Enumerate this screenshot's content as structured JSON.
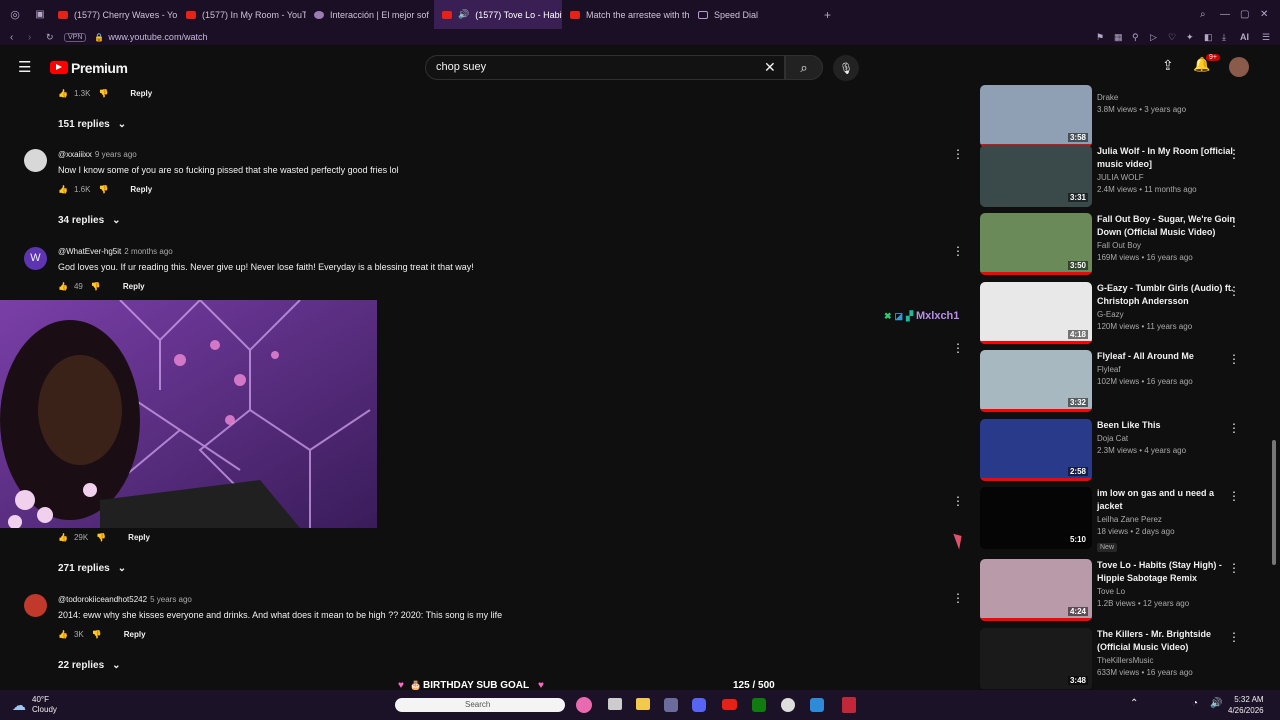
{
  "browser": {
    "tabs": [
      {
        "label": "(1577) Cherry Waves - Yo",
        "kind": "youtube"
      },
      {
        "label": "(1577) In My Room - YouT",
        "kind": "youtube"
      },
      {
        "label": "Interacción | El mejor sof",
        "kind": "other"
      },
      {
        "label": "(1577) Tove Lo - Habit",
        "kind": "youtube",
        "active": true
      },
      {
        "label": "Match the arrestee with th",
        "kind": "other"
      },
      {
        "label": "Speed Dial",
        "kind": "speeddial"
      }
    ],
    "vpn_label": "VPN",
    "url": "www.youtube.com/watch",
    "ai_label": "AI"
  },
  "header": {
    "logo_text": "Premium",
    "search_value": "chop suey",
    "notif_count": "9+"
  },
  "comments": [
    {
      "likes": "1.3K",
      "reply_label": "Reply",
      "replies": "151 replies"
    },
    {
      "author": "@xxaiiixx",
      "time": "9 years ago",
      "text": "Now I know some of you are so fucking pissed that she wasted perfectly good fries lol",
      "likes": "1.6K",
      "reply_label": "Reply",
      "replies": "34 replies"
    },
    {
      "author": "@WhatEver-hg5it",
      "time": "2 months ago",
      "avatar_letter": "W",
      "text": "God loves you. If ur reading this. Never give up! Never lose faith! Everyday is a blessing treat it that way!",
      "likes": "49",
      "reply_label": "Reply"
    },
    {
      "likes": "29K",
      "reply_label": "Reply",
      "replies": "271 replies"
    },
    {
      "author": "@todorokiiceandhot5242",
      "time": "5 years ago",
      "text": "2014: eww why she kisses everyone and drinks. And what does it mean to be high ?? 2020: This song is my life",
      "likes": "3K",
      "reply_label": "Reply",
      "replies": "22 replies"
    }
  ],
  "overlay": {
    "username": "Mxlxch1",
    "goal_label": "BIRTHDAY SUB GOAL",
    "goal_progress": "125 / 500"
  },
  "sidebar": {
    "videos": [
      {
        "title": "",
        "channel": "Drake",
        "stats": "3.8M views • 3 years ago",
        "duration": "3:58",
        "thumb_color": "#8fa0b5"
      },
      {
        "title": "Julia Wolf - In My Room [official music video]",
        "channel": "JULIA WOLF",
        "stats": "2.4M views • 11 months ago",
        "duration": "3:31",
        "thumb_color": "#3a4a4a"
      },
      {
        "title": "Fall Out Boy - Sugar, We're Goin Down (Official Music Video)",
        "channel": "Fall Out Boy",
        "stats": "169M views • 16 years ago",
        "duration": "3:50",
        "thumb_color": "#6a8a5a"
      },
      {
        "title": "G-Eazy - Tumblr Girls (Audio) ft. Christoph Andersson",
        "channel": "G-Eazy",
        "stats": "120M views • 11 years ago",
        "duration": "4:18",
        "thumb_color": "#e8e8e8"
      },
      {
        "title": "Flyleaf - All Around Me",
        "channel": "Flyleaf",
        "stats": "102M views • 16 years ago",
        "duration": "3:32",
        "thumb_color": "#a8b8c0"
      },
      {
        "title": "Been Like This",
        "channel": "Doja Cat",
        "stats": "2.3M views • 4 years ago",
        "duration": "2:58",
        "thumb_color": "#2a3a8a"
      },
      {
        "title": "im low on gas and u need a jacket",
        "channel": "Leilha Zane Perez",
        "stats": "18 views • 2 days ago",
        "badge": "New",
        "duration": "5:10",
        "thumb_color": "#050505"
      },
      {
        "title": "Tove Lo - Habits (Stay High) - Hippie Sabotage Remix",
        "channel": "Tove Lo",
        "stats": "1.2B views • 12 years ago",
        "duration": "4:24",
        "thumb_color": "#b89aa8"
      },
      {
        "title": "The Killers - Mr. Brightside (Official Music Video)",
        "channel": "TheKillersMusic",
        "stats": "633M views • 16 years ago",
        "duration": "3:48",
        "thumb_color": "#1a1a1a"
      }
    ]
  },
  "taskbar": {
    "weather_temp": "40°F",
    "weather_desc": "Cloudy",
    "search_placeholder": "Search",
    "time": "5:32 AM",
    "date": "4/26/2026"
  },
  "colors": {
    "accent": "#ff0000",
    "browser_bg": "#1a0f24"
  }
}
